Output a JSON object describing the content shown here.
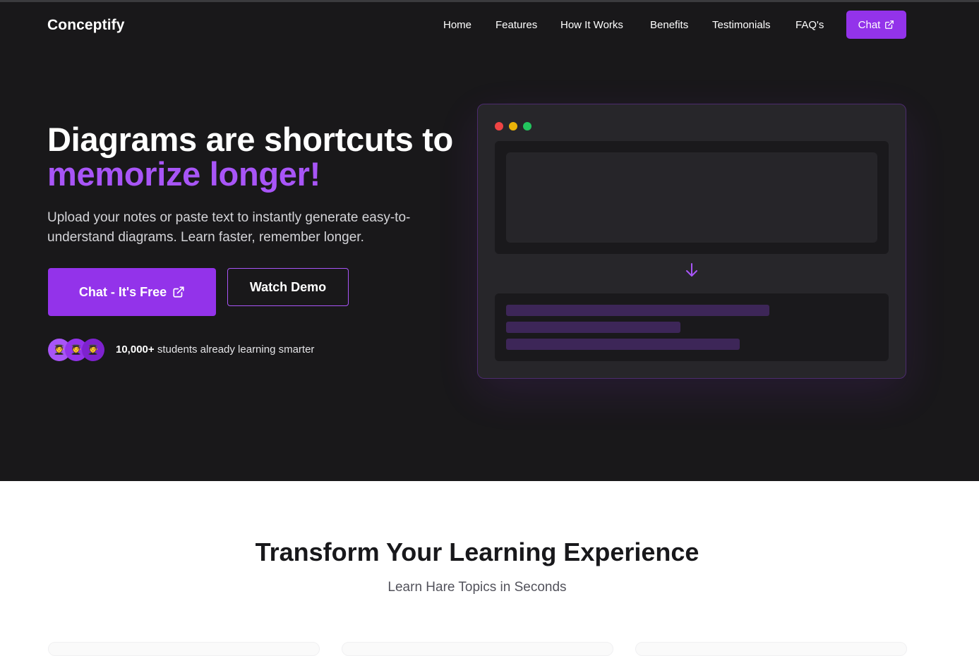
{
  "nav": {
    "brand": "Conceptify",
    "links": [
      "Home",
      "Features",
      "How It Works",
      "Benefits",
      "Testimonials",
      "FAQ's"
    ],
    "chat_label": "Chat",
    "chat_icon": "external-link-icon"
  },
  "hero": {
    "headline_line1": "Diagrams are shortcuts to",
    "headline_accent": "memorize longer!",
    "subtitle": "Upload your notes or paste text to instantly generate easy-to-understand diagrams. Learn faster, remember longer.",
    "primary_button": "Chat - It's Free",
    "secondary_button": "Watch Demo",
    "social_count": "10,000+",
    "social_text": "students already learning smarter",
    "avatar_emoji": "🧑‍🎓"
  },
  "mockup": {
    "window_dots": [
      "#ef4444",
      "#eab308",
      "#22c55e"
    ],
    "arrow_icon": "arrow-down-icon",
    "output_bar_fill": [
      0.71,
      0.47,
      0.63
    ]
  },
  "section": {
    "title": "Transform Your Learning Experience",
    "subtitle": "Learn Hare Topics in Seconds"
  },
  "colors": {
    "accent": "#9333ea",
    "accent_light": "#a855f7",
    "hero_bg": "#19181a"
  }
}
